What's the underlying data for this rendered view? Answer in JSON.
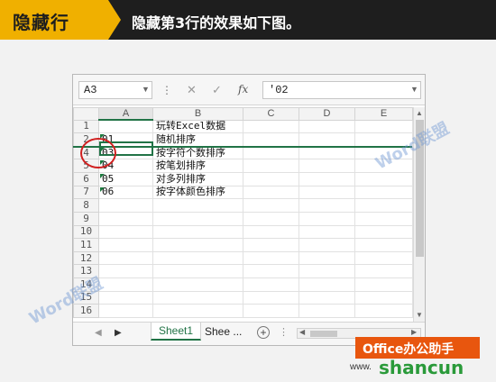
{
  "banner": {
    "tag": "隐藏行",
    "title": "隐藏第3行的效果如下图。"
  },
  "formula_bar": {
    "name_box": "A3",
    "cancel_icon": "✕",
    "confirm_icon": "✓",
    "fx_label": "fx",
    "value": "'02"
  },
  "grid": {
    "columns": [
      "A",
      "B",
      "C",
      "D",
      "E"
    ],
    "rows": [
      {
        "num": "1",
        "a": "",
        "b": "玩转Excel数据",
        "error": false
      },
      {
        "num": "2",
        "a": "01",
        "b": "随机排序",
        "error": true
      },
      {
        "num": "4",
        "a": "03",
        "b": "按字符个数排序",
        "error": true
      },
      {
        "num": "5",
        "a": "04",
        "b": "按笔划排序",
        "error": true
      },
      {
        "num": "6",
        "a": "05",
        "b": "对多列排序",
        "error": true
      },
      {
        "num": "7",
        "a": "06",
        "b": "按字体颜色排序",
        "error": true
      },
      {
        "num": "8",
        "a": "",
        "b": "",
        "error": false
      },
      {
        "num": "9",
        "a": "",
        "b": "",
        "error": false
      },
      {
        "num": "10",
        "a": "",
        "b": "",
        "error": false
      },
      {
        "num": "11",
        "a": "",
        "b": "",
        "error": false
      },
      {
        "num": "12",
        "a": "",
        "b": "",
        "error": false
      },
      {
        "num": "13",
        "a": "",
        "b": "",
        "error": false
      },
      {
        "num": "14",
        "a": "",
        "b": "",
        "error": false
      },
      {
        "num": "15",
        "a": "",
        "b": "",
        "error": false
      },
      {
        "num": "16",
        "a": "",
        "b": "",
        "error": false
      }
    ]
  },
  "tabs": {
    "sheet1": "Sheet1",
    "sheet2": "Shee ...",
    "add": "+"
  },
  "watermarks": {
    "word1": "Word联盟",
    "word2": "Word联盟"
  },
  "branding": {
    "badge": "Office办公助手",
    "site": "shancun",
    "site_www": "www."
  },
  "colors": {
    "excel_green": "#217346",
    "banner_yellow": "#f0b000",
    "circle_red": "#d02020"
  }
}
